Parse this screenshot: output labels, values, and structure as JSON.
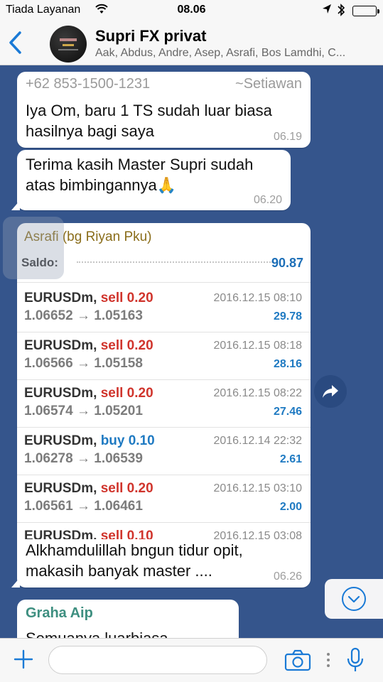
{
  "status_bar": {
    "carrier": "Tiada Layanan",
    "time": "08.06"
  },
  "header": {
    "title": "Supri FX privat",
    "subtitle": "Aak, Abdus, Andre, Asep, Asrafi, Bos Lamdhi, C..."
  },
  "messages": [
    {
      "sender_phone": "+62 853-1500-1231",
      "sender_alias": "~Setiawan",
      "text_line1": "Iya Om, baru 1 TS sudah luar biasa",
      "text_line2": "hasilnya bagi saya",
      "time": "06.19"
    },
    {
      "text_line1": "Terima kasih Master Supri sudah",
      "text_line2": "atas bimbingannya🙏",
      "time": "06.20"
    },
    {
      "text_line1": "Alkhamdulillah bngun tidur opit,",
      "text_line2": "makasih banyak master ....",
      "time": "06.26"
    },
    {
      "sender_name": "Graha  Aip",
      "text_line1": "Semuanya luarbiasa"
    }
  ],
  "image_card": {
    "user_name": "Asrafi (bg Riyan Pku)",
    "saldo_label": "Saldo:",
    "saldo_value": "90.87",
    "trades": [
      {
        "symbol": "EURUSDm,",
        "side": "sell 0.20",
        "side_type": "sell",
        "open": "1.06652",
        "arrow": "→",
        "close": "1.05163",
        "date": "2016.12.15 08:10",
        "profit": "29.78"
      },
      {
        "symbol": "EURUSDm,",
        "side": "sell 0.20",
        "side_type": "sell",
        "open": "1.06566",
        "arrow": "→",
        "close": "1.05158",
        "date": "2016.12.15 08:18",
        "profit": "28.16"
      },
      {
        "symbol": "EURUSDm,",
        "side": "sell 0.20",
        "side_type": "sell",
        "open": "1.06574",
        "arrow": "→",
        "close": "1.05201",
        "date": "2016.12.15 08:22",
        "profit": "27.46"
      },
      {
        "symbol": "EURUSDm,",
        "side": "buy 0.10",
        "side_type": "buy",
        "open": "1.06278",
        "arrow": "→",
        "close": "1.06539",
        "date": "2016.12.14 22:32",
        "profit": "2.61"
      },
      {
        "symbol": "EURUSDm,",
        "side": "sell 0.20",
        "side_type": "sell",
        "open": "1.06561",
        "arrow": "→",
        "close": "1.06461",
        "date": "2016.12.15 03:10",
        "profit": "2.00"
      },
      {
        "symbol": "EURUSDm,",
        "side": "sell 0.10",
        "side_type": "sell",
        "open": "",
        "arrow": "",
        "close": "",
        "date": "2016.12.15 03:08",
        "profit": ""
      }
    ]
  },
  "icons": {
    "back": "chevron-left-icon",
    "forward": "share-forward-icon",
    "scroll_down": "chevron-down-icon",
    "attach": "plus-icon",
    "camera": "camera-icon",
    "mic": "microphone-icon"
  },
  "colors": {
    "chat_background": "#35558c",
    "accent_blue": "#1a7ad6",
    "sell_red": "#d0342c",
    "buy_blue": "#1f7ac2",
    "sender_gold": "#8a6d1a",
    "sender_teal": "#3e8f80"
  }
}
